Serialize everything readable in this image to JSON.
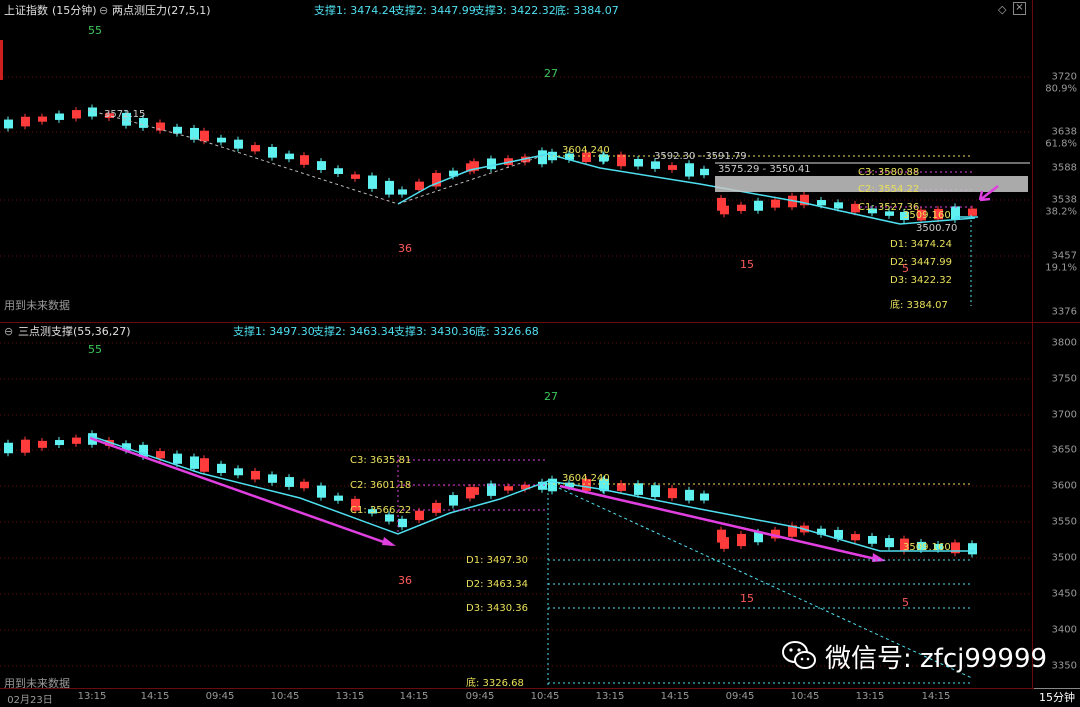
{
  "top": {
    "symbol": "上证指数",
    "period": "(15分钟)",
    "indicator": "两点测压力(27,5,1)",
    "supports": [
      "支撑1: 3474.24",
      "支撑2: 3447.99",
      "支撑3: 3422.32",
      "底: 3384.07"
    ],
    "yaxis": [
      {
        "label": "3720"
      },
      {
        "label": "80.9%"
      },
      {
        "label": "3638"
      },
      {
        "label": "61.8%"
      },
      {
        "label": "3588"
      },
      {
        "label": "3538"
      },
      {
        "label": "38.2%"
      },
      {
        "label": "3457"
      },
      {
        "label": "19.1%"
      },
      {
        "label": "3376"
      }
    ],
    "hint": "用到未来数据",
    "counts": [
      "55",
      "27",
      "36",
      "15",
      "5"
    ],
    "annotations": {
      "peak_left": "3572.15",
      "peak_mid": "3604.240",
      "range1": "3592.30 - 3591.79",
      "range2": "3575.29 - 3550.41",
      "last": "3500.70",
      "cur": "3509.160"
    },
    "levels_c": [
      "C3: 3580.88",
      "C2: 3554.22",
      "C1: 3527.36"
    ],
    "levels_d": [
      "D1: 3474.24",
      "D2: 3447.99",
      "D3: 3422.32",
      "底: 3384.07"
    ]
  },
  "bottom": {
    "indicator": "三点测支撑(55,36,27)",
    "supports": [
      "支撑1: 3497.30",
      "支撑2: 3463.34",
      "支撑3: 3430.36",
      "底: 3326.68"
    ],
    "yaxis": [
      {
        "label": "3800"
      },
      {
        "label": "3750"
      },
      {
        "label": "3700"
      },
      {
        "label": "3650"
      },
      {
        "label": "3600"
      },
      {
        "label": "3550"
      },
      {
        "label": "3500"
      },
      {
        "label": "3450"
      },
      {
        "label": "3400"
      },
      {
        "label": "3350"
      }
    ],
    "hint": "用到未来数据",
    "counts": [
      "55",
      "27",
      "36",
      "15",
      "5"
    ],
    "annotations": {
      "peak": "3604.240",
      "cur": "3509.160"
    },
    "levels_c": [
      "C3: 3635.81",
      "C2: 3601.18",
      "C1: 3566.22"
    ],
    "levels_d": [
      "D1: 3497.30",
      "D2: 3463.34",
      "D3: 3430.36",
      "底: 3326.68"
    ]
  },
  "xaxis": [
    "02月23日",
    "13:15",
    "14:15",
    "09:45",
    "10:45",
    "13:15",
    "14:15",
    "09:45",
    "10:45",
    "13:15",
    "14:15",
    "09:45",
    "10:45",
    "13:15",
    "14:15"
  ],
  "timeframe": "15分钟",
  "watermark": "微信号: zfcj99999",
  "colors": {
    "up": "#ff3b3b",
    "down": "#5ff0f0",
    "cyan": "#4fe0f0",
    "yellow": "#e8e05a",
    "magenta": "#e040e0",
    "grid": "#6a0c0c"
  }
}
